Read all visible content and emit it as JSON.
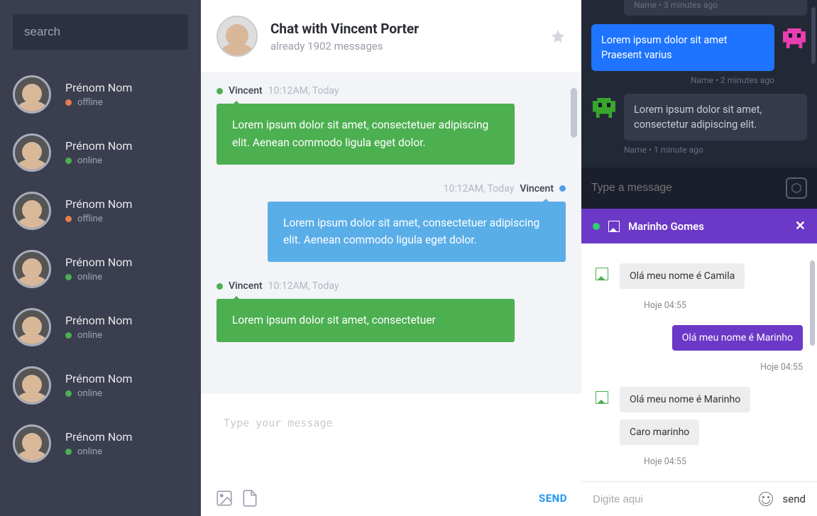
{
  "sidebar": {
    "search_placeholder": "search",
    "contacts": [
      {
        "name": "Prénom Nom",
        "status": "offline",
        "dot": "offline"
      },
      {
        "name": "Prénom Nom",
        "status": "online",
        "dot": "online"
      },
      {
        "name": "Prénom Nom",
        "status": "offline",
        "dot": "offline"
      },
      {
        "name": "Prénom Nom",
        "status": "online",
        "dot": "online"
      },
      {
        "name": "Prénom Nom",
        "status": "online",
        "dot": "online"
      },
      {
        "name": "Prénom Nom",
        "status": "online",
        "dot": "online"
      },
      {
        "name": "Prénom Nom",
        "status": "online",
        "dot": "online"
      }
    ]
  },
  "main": {
    "title": "Chat with Vincent Porter",
    "subtitle": "already 1902 messages",
    "composer_placeholder": "Type your message",
    "send_label": "SEND",
    "messages": [
      {
        "side": "left",
        "who": "Vincent",
        "time": "10:12AM, Today",
        "text": "Lorem ipsum dolor sit amet, consectetuer adipiscing elit. Aenean commodo ligula eget dolor."
      },
      {
        "side": "right",
        "who": "Vincent",
        "time": "10:12AM, Today",
        "text": "Lorem ipsum dolor sit amet, consectetuer adipiscing elit. Aenean commodo ligula eget dolor."
      },
      {
        "side": "left",
        "who": "Vincent",
        "time": "10:12AM, Today",
        "text": "Lorem ipsum dolor sit amet, consectetuer"
      }
    ]
  },
  "dark": {
    "top_meta": "Name • 3 minutes ago",
    "out_text": "Lorem ipsum dolor sit amet Praesent varius",
    "out_meta": "Name • 2 minutes ago",
    "in_text": "Lorem ipsum dolor sit amet, consectetur adipiscing elit.",
    "in_meta": "Name • 1 minute ago",
    "input_placeholder": "Type a message"
  },
  "pchat": {
    "header_name": "Marinho Gomes",
    "groups": [
      {
        "side": "in",
        "bubs": [
          "Olá meu nome é Camila"
        ],
        "time": "Hoje 04:55"
      },
      {
        "side": "out",
        "bubs": [
          "Olá meu nome é Marinho"
        ],
        "time": "Hoje 04:55"
      },
      {
        "side": "in",
        "bubs": [
          "Olá meu nome é Marinho",
          "Caro marinho"
        ],
        "time": "Hoje 04:55"
      }
    ],
    "input_placeholder": "Digite aqui",
    "send_label": "send"
  }
}
